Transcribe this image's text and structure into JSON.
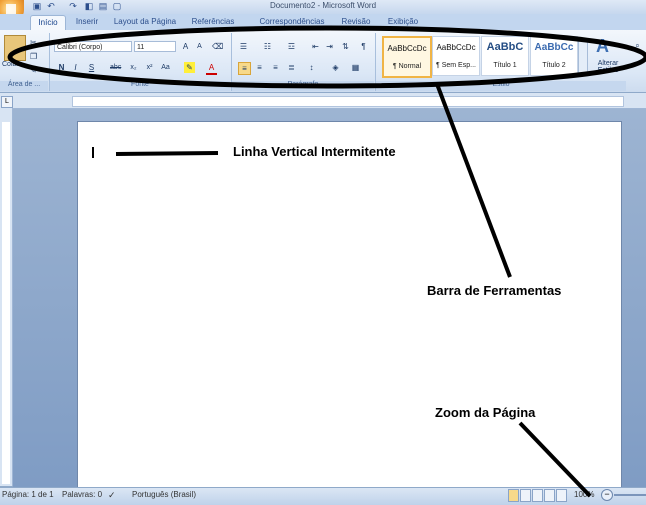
{
  "window": {
    "title": "Documento2 - Microsoft Word"
  },
  "tabs": [
    "Início",
    "Inserir",
    "Layout da Página",
    "Referências",
    "Correspondências",
    "Revisão",
    "Exibição"
  ],
  "ribbon": {
    "paste_label": "Colar",
    "font_name": "Calibri (Corpo)",
    "font_size": "11",
    "groups": {
      "clipboard": "Área de ...",
      "font": "Fonte",
      "paragraph": "Parágrafo",
      "styles": "Estilo"
    },
    "styles": [
      {
        "preview": "AaBbCcDc",
        "name": "¶ Normal"
      },
      {
        "preview": "AaBbCcDc",
        "name": "¶ Sem Esp..."
      },
      {
        "preview": "AaBbC",
        "name": "Título 1"
      },
      {
        "preview": "AaBbCc",
        "name": "Título 2"
      }
    ],
    "change_styles_label": "Alterar Estilos"
  },
  "status": {
    "page": "Página: 1 de 1",
    "words": "Palavras: 0",
    "language": "Português (Brasil)",
    "zoom": "100%"
  },
  "annotations": {
    "cursor": "Linha Vertical Intermitente",
    "toolbar": "Barra de Ferramentas",
    "zoom": "Zoom da Página"
  }
}
